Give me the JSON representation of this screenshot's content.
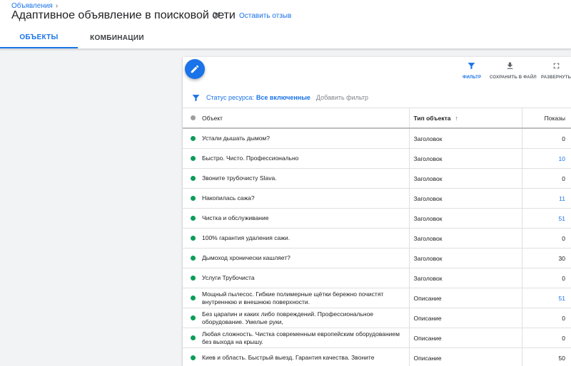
{
  "header": {
    "breadcrumb": "Объявления",
    "title": "Адаптивное объявление в поисковой сети",
    "feedback": "Оставить отзыв",
    "tabs": [
      "ОБЪЕКТЫ",
      "КОМБИНАЦИИ"
    ]
  },
  "toolbar": {
    "filter": "ФИЛЬТР",
    "save": "СОХРАНИТЬ В ФАЙЛ",
    "expand": "РАЗВЕРНУТЬ"
  },
  "filterbar": {
    "label": "Статус ресурса:",
    "value": "Все включенные",
    "add": "Добавить фильтр"
  },
  "table": {
    "headers": [
      "Объект",
      "Тип объекта",
      "Показы"
    ],
    "rows": [
      {
        "object": "Устали дышать дымом?",
        "type": "Заголовок",
        "impressions": "0"
      },
      {
        "object": "Быстро. Чисто. Профессионально",
        "type": "Заголовок",
        "impressions": "10"
      },
      {
        "object": "Звоните трубочисту Slava.",
        "type": "Заголовок",
        "impressions": "0"
      },
      {
        "object": "Накопилась сажа?",
        "type": "Заголовок",
        "impressions": "11"
      },
      {
        "object": "Чистка и обслуживание",
        "type": "Заголовок",
        "impressions": "51"
      },
      {
        "object": "100% гарантия удаления сажи.",
        "type": "Заголовок",
        "impressions": "0"
      },
      {
        "object": "Дымоход хронически кашляет?",
        "type": "Заголовок",
        "impressions": "30"
      },
      {
        "object": "Услуги Трубочиста",
        "type": "Заголовок",
        "impressions": "0"
      },
      {
        "object": "Мощный пылесос. Гибкие полимерные щётки бережно почистят внутреннюю и внешнюю поверхности.",
        "type": "Описание",
        "impressions": "51"
      },
      {
        "object": "Без царапин и каких либо повреждений. Профессиональное оборудование. Умелые руки,",
        "type": "Описание",
        "impressions": "0"
      },
      {
        "object": "Любая сложность. Чистка современным европейским оборудованием без выхода на крышу.",
        "type": "Описание",
        "impressions": "0"
      },
      {
        "object": "Киев и область. Быстрый выезд. Гарантия качества. Звоните",
        "type": "Описание",
        "impressions": "50"
      }
    ]
  },
  "colors": {
    "accent": "#1a73e8",
    "status_enabled": "#0d9d58",
    "background": "#f1f3f4"
  }
}
